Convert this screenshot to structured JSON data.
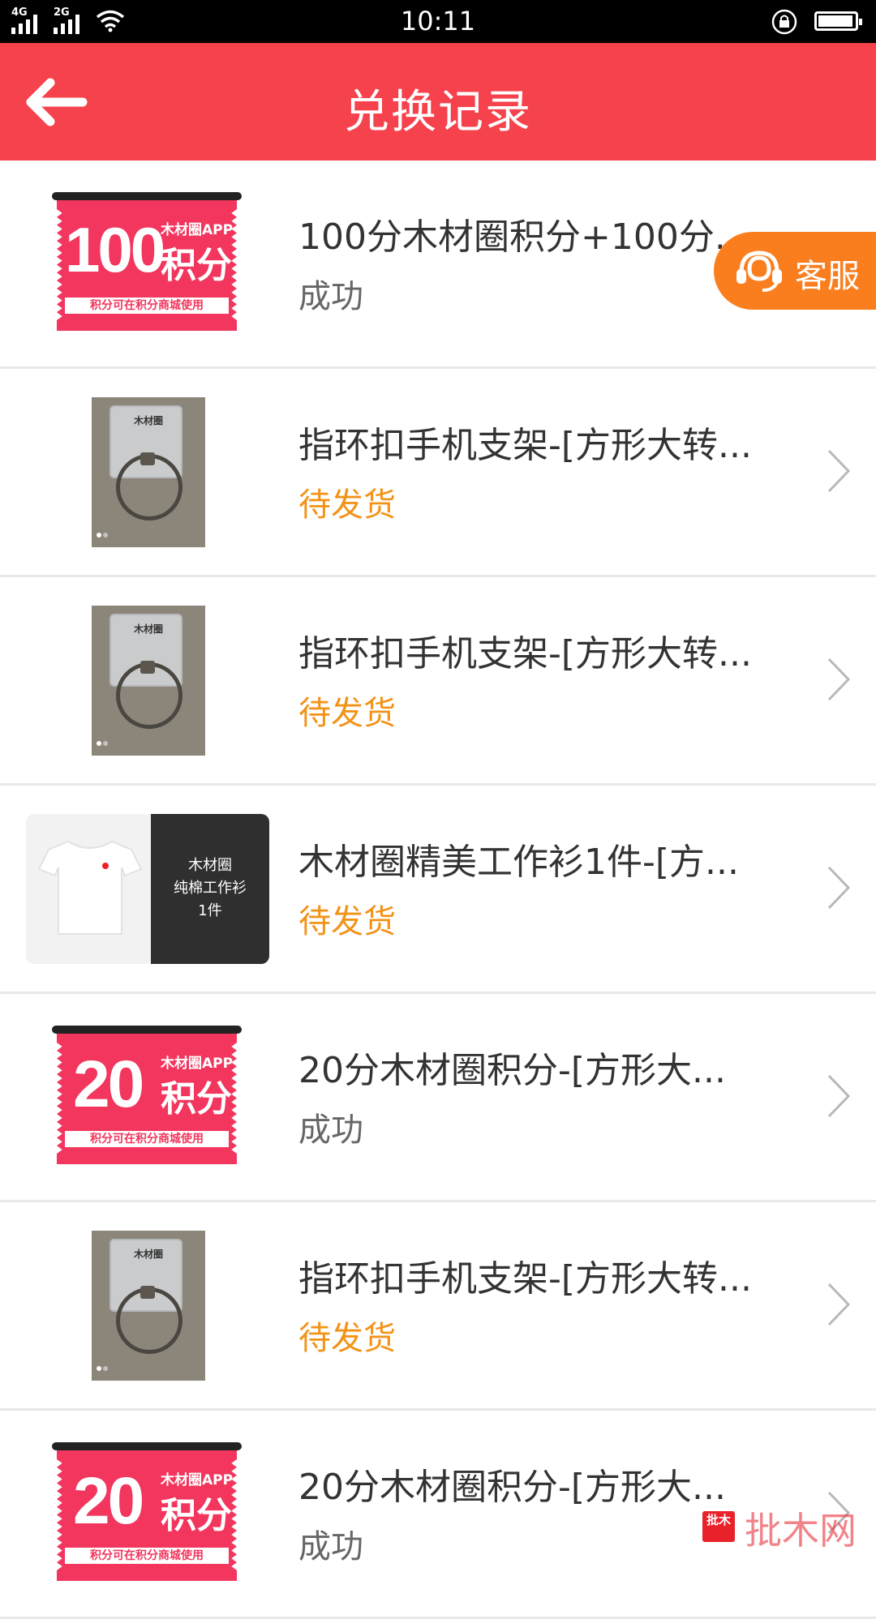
{
  "status_bar": {
    "time": "10:11",
    "network_1": "4G",
    "network_2": "2G",
    "battery_level": 0.95
  },
  "header": {
    "title": "兑换记录"
  },
  "records": [
    {
      "name": "100分木材圈积分+100分...",
      "status": "成功",
      "status_type": "ok",
      "thumb": {
        "type": "coupon",
        "amount": "100",
        "app_text": "木材圈APP",
        "points_text": "积分",
        "band_text": "积分可在积分商城使用"
      }
    },
    {
      "name": "指环扣手机支架-[方形大转...",
      "status": "待发货",
      "status_type": "pending",
      "thumb": {
        "type": "ring",
        "brand": "木材圈"
      }
    },
    {
      "name": "指环扣手机支架-[方形大转...",
      "status": "待发货",
      "status_type": "pending",
      "thumb": {
        "type": "ring",
        "brand": "木材圈"
      }
    },
    {
      "name": "木材圈精美工作衫1件-[方...",
      "status": "待发货",
      "status_type": "pending",
      "thumb": {
        "type": "shirt",
        "lines": [
          "木材圈",
          "纯棉工作衫",
          "1件"
        ]
      }
    },
    {
      "name": "20分木材圈积分-[方形大...",
      "status": "成功",
      "status_type": "ok",
      "thumb": {
        "type": "coupon",
        "amount": "20",
        "app_text": "木材圈APP",
        "points_text": "积分",
        "band_text": "积分可在积分商城使用"
      }
    },
    {
      "name": "指环扣手机支架-[方形大转...",
      "status": "待发货",
      "status_type": "pending",
      "thumb": {
        "type": "ring",
        "brand": "木材圈"
      }
    },
    {
      "name": "20分木材圈积分-[方形大...",
      "status": "成功",
      "status_type": "ok",
      "thumb": {
        "type": "coupon",
        "amount": "20",
        "app_text": "木材圈APP",
        "points_text": "积分",
        "band_text": "积分可在积分商城使用"
      }
    }
  ],
  "service_button": {
    "label": "客服"
  },
  "watermark": {
    "tag": "批木",
    "text": "批木网"
  },
  "colors": {
    "header_bg": "#f5424c",
    "pending": "#f29318",
    "ok": "#666666",
    "service_bg": "#fb7e1e",
    "coupon_bg": "#f2365e"
  },
  "icons": {
    "back": "back-arrow-icon",
    "chevron": "chevron-right-icon",
    "service": "headset-icon"
  }
}
